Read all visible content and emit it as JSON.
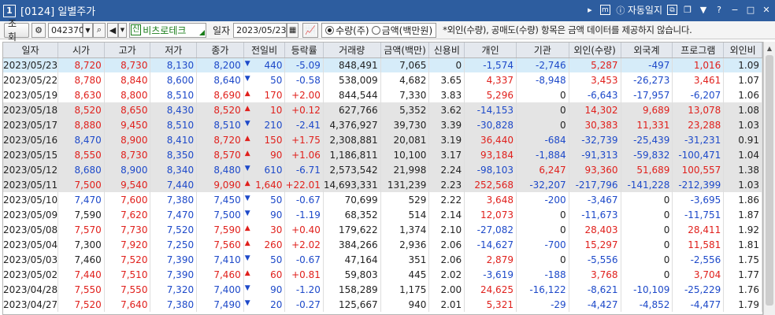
{
  "window": {
    "number": "1",
    "title": "[0124] 일별주가",
    "auto_log": "자동일지"
  },
  "toolbar": {
    "query_label": "조회",
    "code": "042370",
    "company": "비츠로테크",
    "date_label": "일자",
    "date": "2023/05/23",
    "radio_qty": "수량(주)",
    "radio_amt": "금액(백만원)",
    "notice": "*외인(수량), 공매도(수량) 항목은 금액 데이터를 제공하지 않습니다."
  },
  "columns": [
    "일자",
    "시가",
    "고가",
    "저가",
    "종가",
    "전일비",
    "등락률",
    "거래량",
    "금액(백만)",
    "신용비",
    "개인",
    "기관",
    "외인(수량)",
    "외국계",
    "프로그램",
    "외인비"
  ],
  "rows": [
    [
      "2023/05/23",
      "8,720",
      "8,730",
      "8,130",
      "8,200",
      "440",
      "-5.09",
      "848,491",
      "7,065",
      "0",
      "-1,574",
      "-2,746",
      "5,287",
      "-497",
      "1,016",
      "1.09"
    ],
    [
      "2023/05/22",
      "8,780",
      "8,840",
      "8,600",
      "8,640",
      "50",
      "-0.58",
      "538,009",
      "4,682",
      "3.65",
      "4,337",
      "-8,948",
      "3,453",
      "-26,273",
      "3,461",
      "1.07"
    ],
    [
      "2023/05/19",
      "8,630",
      "8,800",
      "8,510",
      "8,690",
      "170",
      "+2.00",
      "844,544",
      "7,330",
      "3.83",
      "5,296",
      "0",
      "-6,643",
      "-17,957",
      "-6,207",
      "1.06"
    ],
    [
      "2023/05/18",
      "8,520",
      "8,650",
      "8,430",
      "8,520",
      "10",
      "+0.12",
      "627,766",
      "5,352",
      "3.62",
      "-14,153",
      "0",
      "14,302",
      "9,689",
      "13,078",
      "1.08"
    ],
    [
      "2023/05/17",
      "8,880",
      "9,450",
      "8,510",
      "8,510",
      "210",
      "-2.41",
      "4,376,927",
      "39,730",
      "3.39",
      "-30,828",
      "0",
      "30,383",
      "11,331",
      "23,288",
      "1.03"
    ],
    [
      "2023/05/16",
      "8,470",
      "8,900",
      "8,410",
      "8,720",
      "150",
      "+1.75",
      "2,308,881",
      "20,081",
      "3.19",
      "36,440",
      "-684",
      "-32,739",
      "-25,439",
      "-31,231",
      "0.91"
    ],
    [
      "2023/05/15",
      "8,550",
      "8,730",
      "8,350",
      "8,570",
      "90",
      "+1.06",
      "1,186,811",
      "10,100",
      "3.17",
      "93,184",
      "-1,884",
      "-91,313",
      "-59,832",
      "-100,471",
      "1.04"
    ],
    [
      "2023/05/12",
      "8,680",
      "8,900",
      "8,340",
      "8,480",
      "610",
      "-6.71",
      "2,573,542",
      "21,998",
      "2.24",
      "-98,103",
      "6,247",
      "93,360",
      "51,689",
      "100,557",
      "1.38"
    ],
    [
      "2023/05/11",
      "7,500",
      "9,540",
      "7,440",
      "9,090",
      "1,640",
      "+22.01",
      "14,693,331",
      "131,239",
      "2.23",
      "252,568",
      "-32,207",
      "-217,796",
      "-141,228",
      "-212,399",
      "1.03"
    ],
    [
      "2023/05/10",
      "7,470",
      "7,600",
      "7,380",
      "7,450",
      "50",
      "-0.67",
      "70,699",
      "529",
      "2.22",
      "3,648",
      "-200",
      "-3,467",
      "0",
      "-3,695",
      "1.86"
    ],
    [
      "2023/05/09",
      "7,590",
      "7,620",
      "7,470",
      "7,500",
      "90",
      "-1.19",
      "68,352",
      "514",
      "2.14",
      "12,073",
      "0",
      "-11,673",
      "0",
      "-11,751",
      "1.87"
    ],
    [
      "2023/05/08",
      "7,570",
      "7,730",
      "7,520",
      "7,590",
      "30",
      "+0.40",
      "179,622",
      "1,374",
      "2.10",
      "-27,082",
      "0",
      "28,403",
      "0",
      "28,411",
      "1.92"
    ],
    [
      "2023/05/04",
      "7,300",
      "7,920",
      "7,250",
      "7,560",
      "260",
      "+2.02",
      "384,266",
      "2,936",
      "2.06",
      "-14,627",
      "-700",
      "15,297",
      "0",
      "11,581",
      "1.81"
    ],
    [
      "2023/05/03",
      "7,460",
      "7,520",
      "7,390",
      "7,410",
      "50",
      "-0.67",
      "47,164",
      "351",
      "2.06",
      "2,879",
      "0",
      "-5,556",
      "0",
      "-2,556",
      "1.75"
    ],
    [
      "2023/05/02",
      "7,440",
      "7,510",
      "7,390",
      "7,460",
      "60",
      "+0.81",
      "59,803",
      "445",
      "2.02",
      "-3,619",
      "-188",
      "3,768",
      "0",
      "3,704",
      "1.77"
    ],
    [
      "2023/04/28",
      "7,550",
      "7,550",
      "7,320",
      "7,400",
      "90",
      "-1.20",
      "158,289",
      "1,175",
      "2.00",
      "24,625",
      "-16,122",
      "-8,621",
      "-10,109",
      "-25,229",
      "1.76"
    ],
    [
      "2023/04/27",
      "7,520",
      "7,640",
      "7,380",
      "7,490",
      "20",
      "-0.27",
      "125,667",
      "940",
      "2.01",
      "5,321",
      "-29",
      "-4,427",
      "-4,852",
      "-4,477",
      "1.79"
    ]
  ],
  "colors": {
    "up": "#e0201c",
    "down": "#1d49c9",
    "title_bg": "#2d5d9f",
    "selected_row": "#d6ecf9",
    "alt_row": "#e4e4e4"
  }
}
